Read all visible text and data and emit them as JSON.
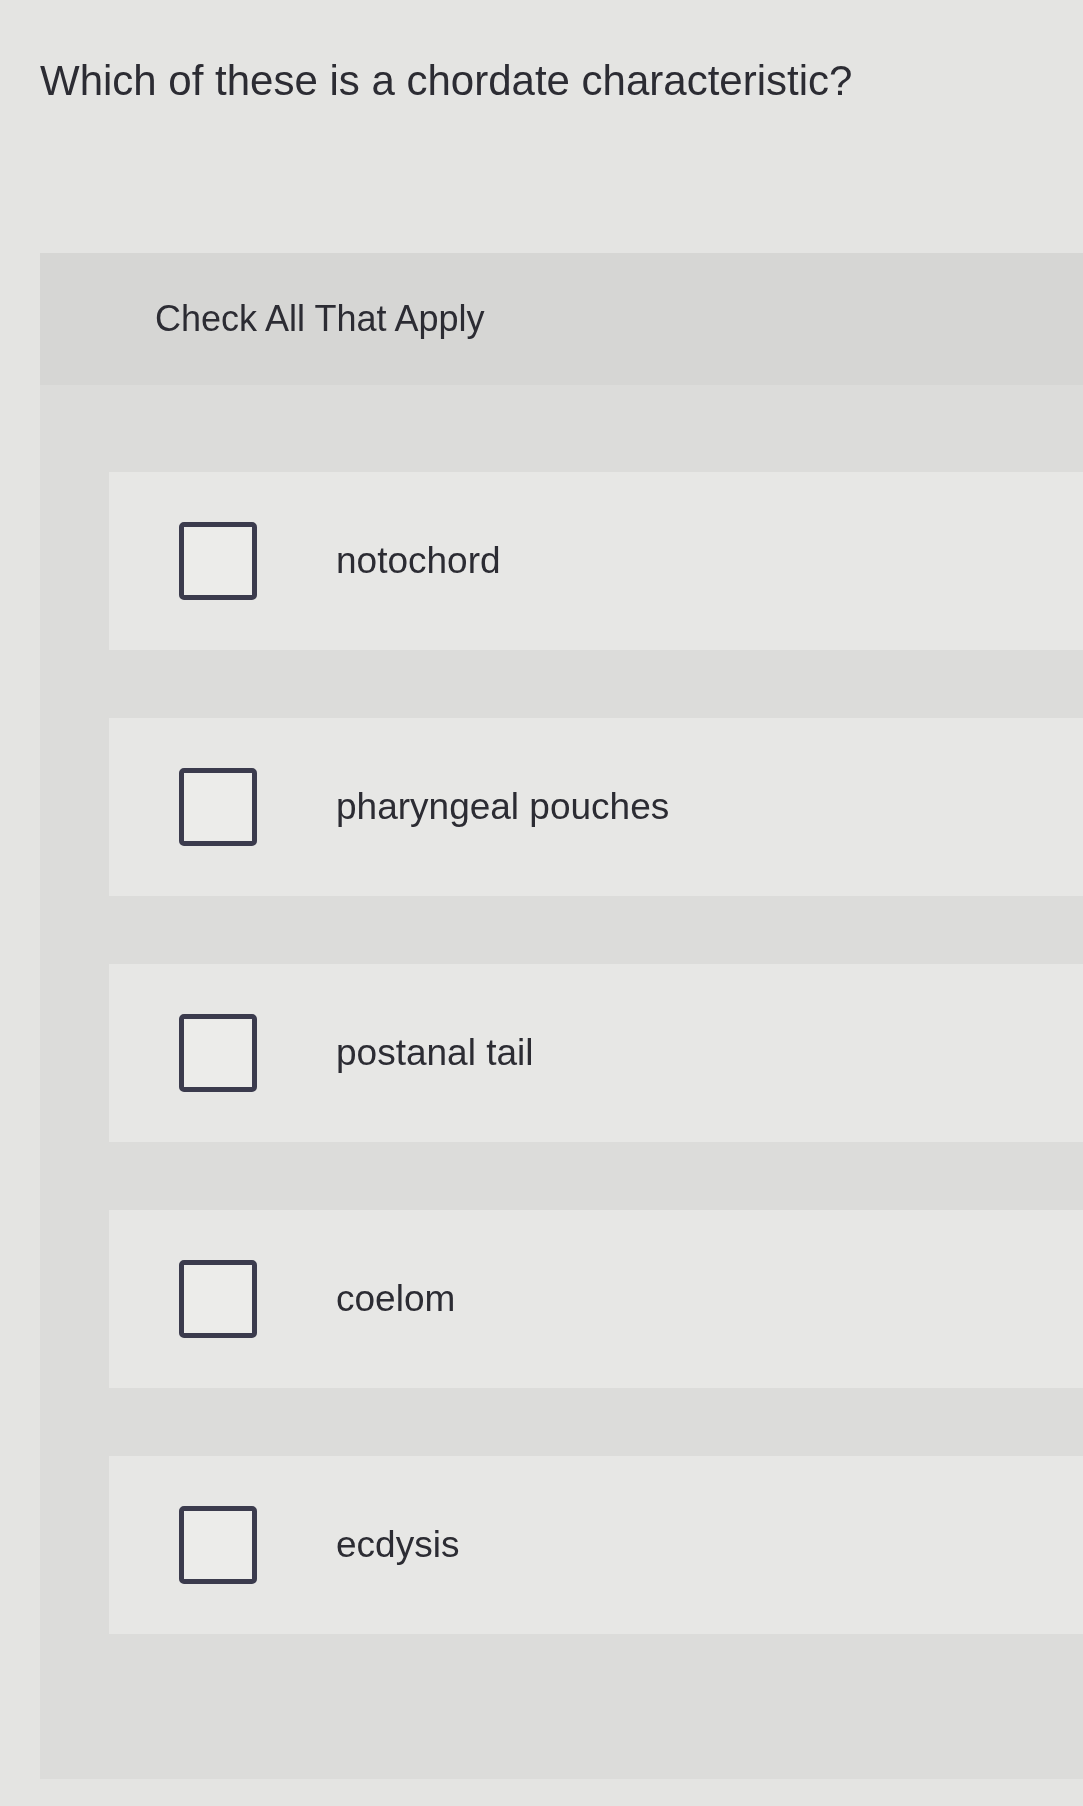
{
  "question": "Which of these is a chordate characteristic?",
  "instruction": "Check All That Apply",
  "options": [
    {
      "label": "notochord",
      "checked": false
    },
    {
      "label": "pharyngeal pouches",
      "checked": false
    },
    {
      "label": "postanal tail",
      "checked": false
    },
    {
      "label": "coelom",
      "checked": false
    },
    {
      "label": "ecdysis",
      "checked": false
    }
  ]
}
